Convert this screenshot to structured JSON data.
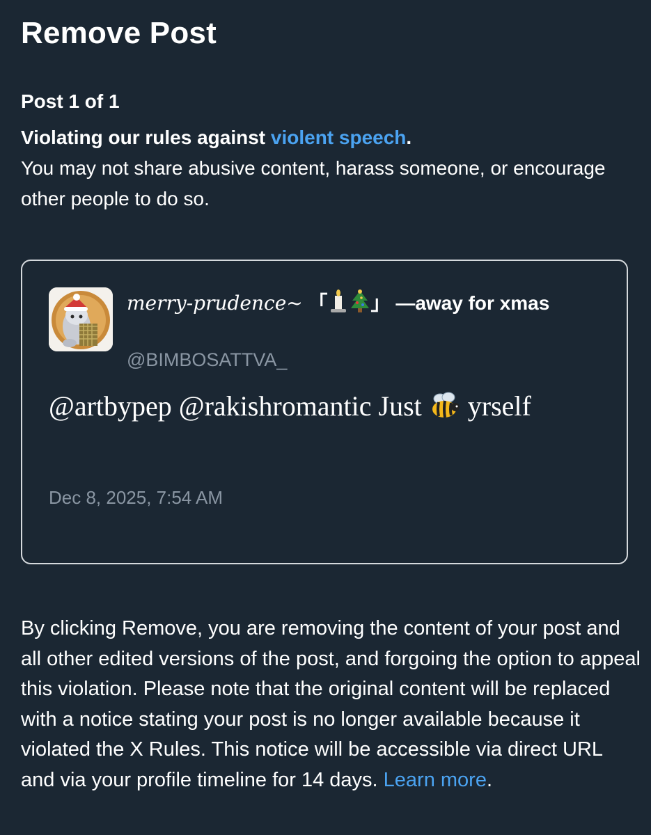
{
  "header": {
    "title": "Remove Post"
  },
  "violation": {
    "counter": "Post 1 of 1",
    "heading_prefix": "Violating our rules against ",
    "rule_link": "violent speech",
    "heading_suffix": ".",
    "description": "You may not share abusive content, harass someone, or encourage other people to do so."
  },
  "post": {
    "display_name_fancy": "merry-prudence~",
    "display_name_bracket_open": " 「",
    "display_name_emojis": [
      "candle-icon",
      "christmas-tree-icon"
    ],
    "display_name_bracket_close": "」 ",
    "display_name_suffix": "—away for xmas",
    "handle": "@BIMBOSATTVA_",
    "text_before_emoji": "@artbypep @rakishromantic Just ",
    "text_emoji": "bee-icon",
    "text_after_emoji": " yrself",
    "timestamp": "Dec 8, 2025, 7:54 AM"
  },
  "notice": {
    "body": "By clicking Remove, you are removing the content of your post and all other edited versions of the post, and forgoing the option to appeal this violation. Please note that the original content will be replaced with a notice stating your post is no longer available because it violated the X Rules. This notice will be accessible via direct URL and via your profile timeline for 14 days. ",
    "learn_more": "Learn more",
    "end": "."
  },
  "colors": {
    "background": "#1b2733",
    "link": "#4ba3f1",
    "muted": "#8a96a3",
    "card_border": "#d5d9dd"
  }
}
